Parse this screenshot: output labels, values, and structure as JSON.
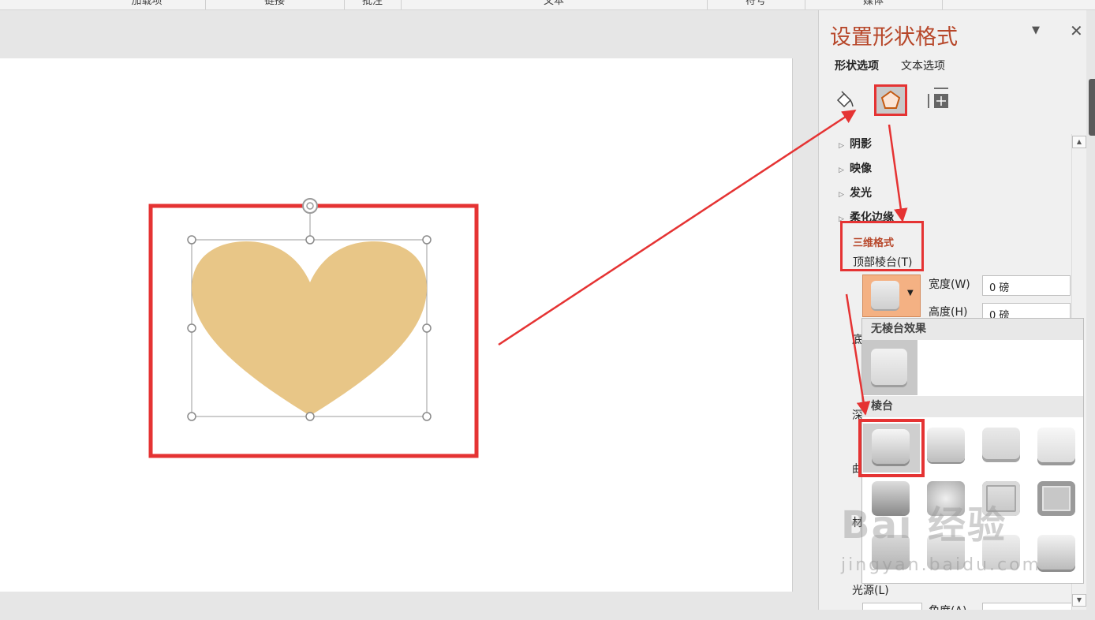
{
  "ribbon": {
    "groups": [
      "加载项",
      "链接",
      "批注",
      "文本",
      "符号",
      "媒体"
    ]
  },
  "pane": {
    "title": "设置形状格式",
    "tabs": [
      "形状选项",
      "文本选项"
    ],
    "sections": [
      "阴影",
      "映像",
      "发光",
      "柔化边缘"
    ],
    "expanded_section": "三维格式",
    "top_bevel_label": "顶部棱台(T)",
    "width_label": "宽度(W)",
    "width_value": "0 磅",
    "height_label": "高度(H)",
    "height_value": "0 磅",
    "truncated_labels": [
      "底",
      "深",
      "曲",
      "材"
    ],
    "light_label": "光源(L)",
    "angle_label": "角度(A)"
  },
  "gallery": {
    "no_bevel_header": "无棱台效果",
    "bevel_header": "棱台"
  },
  "watermark": {
    "main": "Bai 经验",
    "sub": "jingyan.baidu.com"
  },
  "colors": {
    "heart": "#e8c687",
    "highlight": "#e53333",
    "title": "#b7472a"
  }
}
